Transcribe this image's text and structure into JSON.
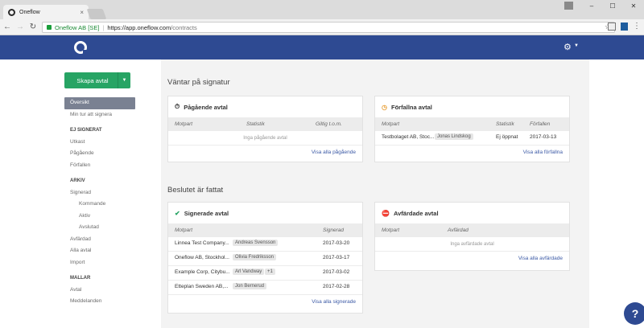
{
  "browser": {
    "tab_title": "Oneflow",
    "secure_name": "Oneflow AB [SE]",
    "url_host": "https://app.oneflow.com",
    "url_path": "/contracts"
  },
  "sidebar": {
    "create_button": "Skapa avtal",
    "items": {
      "overview": "Översikt",
      "min_tur": "Min tur att signera",
      "head_ej_signerat": "EJ SIGNERAT",
      "utkast": "Utkast",
      "pagaende": "Pågående",
      "forfallen": "Förfallen",
      "head_arkiv": "ARKIV",
      "signerad": "Signerad",
      "kommande": "Kommande",
      "aktiv": "Aktiv",
      "avslutad": "Avslutad",
      "avfardad": "Avfärdad",
      "alla_avtal": "Alla avtal",
      "import": "Import",
      "head_mallar": "MALLAR",
      "avtal": "Avtal",
      "meddelanden": "Meddelanden"
    }
  },
  "sections": {
    "awaiting": "Väntar på signatur",
    "decided": "Beslutet är fattat"
  },
  "cards": {
    "ongoing": {
      "title": "Pågående avtal",
      "cols": [
        "Motpart",
        "Statistik",
        "Giltig t.o.m."
      ],
      "empty": "Inga pågående avtal",
      "link": "Visa alla pågående"
    },
    "expired": {
      "title": "Förfallna avtal",
      "cols": [
        "Motpart",
        "Statistik",
        "Förfallen"
      ],
      "rows": [
        {
          "party": "Testbolaget AB, Stoc...",
          "person": "Jonas Lindskog",
          "stat": "Ej öppnat",
          "date": "2017-03-13"
        }
      ],
      "link": "Visa alla förfallna"
    },
    "signed": {
      "title": "Signerade avtal",
      "cols": [
        "Motpart",
        "Signerad"
      ],
      "rows": [
        {
          "party": "Linnea Test Company...",
          "person": "Andreas Svensson",
          "extra": "",
          "date": "2017-03-20"
        },
        {
          "party": "Oneflow AB, Stockhol...",
          "person": "Olivia Fredriksson",
          "extra": "",
          "date": "2017-03-17"
        },
        {
          "party": "Example Corp, Citybu...",
          "person": "Arl Vandway",
          "extra": "+1",
          "date": "2017-03-02"
        },
        {
          "party": "Etteplan Sweden AB,...",
          "person": "Jon Bernerud",
          "extra": "",
          "date": "2017-02-28"
        }
      ],
      "link": "Visa alla signerade"
    },
    "declined": {
      "title": "Avfärdade avtal",
      "cols": [
        "Motpart",
        "Avfärdad"
      ],
      "empty": "Inga avfärdade avtal",
      "link": "Visa alla avfärdade"
    }
  },
  "colors": {
    "header": "#2e4a92",
    "create_button": "#27a464",
    "active_nav": "#7a8192",
    "link": "#3c5aa6"
  }
}
